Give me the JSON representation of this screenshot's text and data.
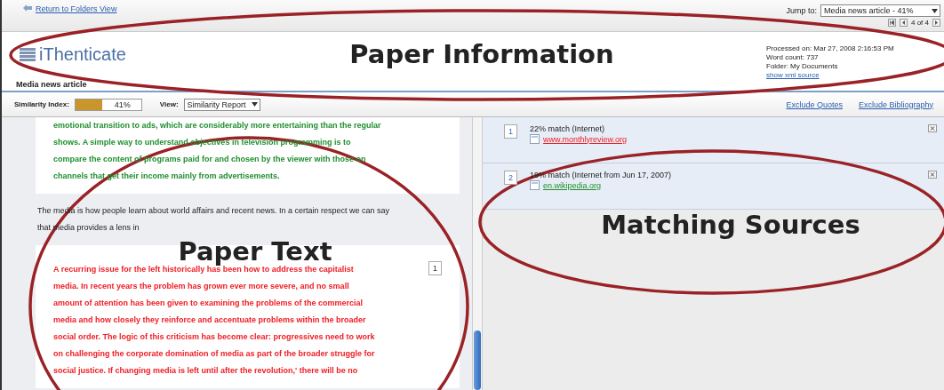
{
  "top_bar": {
    "back_link": "Return to Folders View",
    "jump_label": "Jump to:",
    "jump_value": "Media news article - 41%",
    "pager": "4 of 4"
  },
  "header": {
    "logo": "iThenticate",
    "paper_title": "Media news article",
    "info": [
      "Processed on: Mar 27, 2008 2:16:53 PM",
      "Word count: 737",
      "Folder: My Documents"
    ],
    "source_link": "show xml source"
  },
  "toolbar": {
    "similarity_label": "Similarity Index:",
    "similarity": {
      "level": 0.41,
      "reading": "41%"
    },
    "view_label": "View:",
    "view_value": "Similarity Report",
    "links": [
      "Exclude Quotes",
      "Exclude Bibliography"
    ]
  },
  "paper_text": [
    {
      "kind": "match",
      "color": "#1f8f2f",
      "lines": [
        "emotional transition to ads, which are considerably more entertaining than the regular",
        "shows. A simple way to understand objectives in television programming is to",
        "compare the content of programs paid for and chosen by the viewer with those on",
        "channels that get their income mainly from advertisements."
      ]
    },
    {
      "kind": "plain",
      "lines": [
        "The media is how people learn about world affairs and recent news. In a certain respect we can say",
        "that media provides a lens in"
      ]
    },
    {
      "kind": "match",
      "color": "#ee1c24",
      "number": "1",
      "lines": [
        "A recurring issue for the left historically has been how to address the capitalist",
        "media. In recent years the problem has grown ever more severe, and no small",
        "amount of attention has been given to examining the problems of the commercial",
        "media and how closely they reinforce and accentuate problems within the broader",
        "social order. The logic of this criticism has become clear: progressives need to work",
        "on challenging the corporate domination of media as part of the broader struggle for",
        "social justice. If changing media is left until after the revolution,' there will be no"
      ]
    }
  ],
  "sources": [
    {
      "number": "1",
      "match": "22% match (Internet)",
      "url": "www.monthlyreview.org",
      "color": "#ee1c24"
    },
    {
      "number": "2",
      "match": "19% match (Internet from Jun 17, 2007)",
      "url": "en.wikipedia.org",
      "color": "#1f8f2f"
    }
  ],
  "annotations": [
    {
      "label": "Paper Information"
    },
    {
      "label": "Paper Text"
    },
    {
      "label": "Matching Sources"
    }
  ]
}
